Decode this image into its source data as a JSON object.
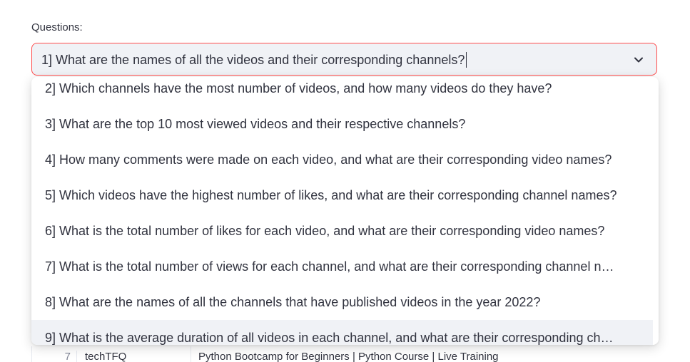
{
  "label": "Questions:",
  "select": {
    "value": "1] What are the names of all the videos and their corresponding channels?"
  },
  "options": [
    "2] Which channels have the most number of videos, and how many videos do they have?",
    "3] What are the top 10 most viewed videos and their respective channels?",
    "4] How many comments were made on each video, and what are their corresponding video names?",
    "5] Which videos have the highest number of likes, and what are their corresponding channel names?",
    "6] What is the total number of likes for each video, and what are their corresponding video names?",
    "7] What is the total number of views for each channel, and what are their corresponding channel n…",
    "8] What are the names of all the channels that have published videos in the year 2022?",
    "9] What is the average duration of all videos in each channel, and what are their corresponding ch…"
  ],
  "table_peek": {
    "index": "7",
    "channel": "techTFQ",
    "video": "Python Bootcamp for Beginners | Python Course | Live Training"
  },
  "colors": {
    "accent": "#ff4b4b",
    "select_bg": "#f0f2f6",
    "text": "#31333f"
  }
}
